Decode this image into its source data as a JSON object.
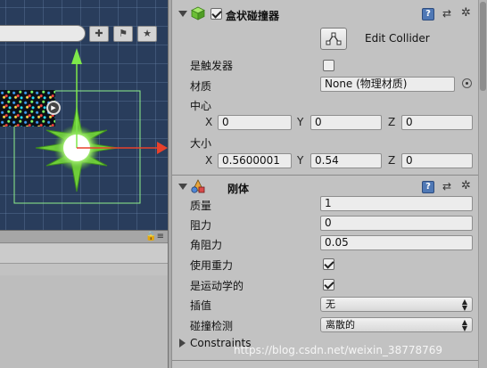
{
  "inspector": {
    "box_collider": {
      "title": "盒状碰撞器",
      "enabled": true,
      "edit_collider_label": "Edit Collider",
      "is_trigger_label": "是触发器",
      "is_trigger": false,
      "material_label": "材质",
      "material_value": "None (物理材质)",
      "center_label": "中心",
      "center": {
        "x_label": "X",
        "x": "0",
        "y_label": "Y",
        "y": "0",
        "z_label": "Z",
        "z": "0"
      },
      "size_label": "大小",
      "size": {
        "x_label": "X",
        "x": "0.5600001",
        "y_label": "Y",
        "y": "0.54",
        "z_label": "Z",
        "z": "0"
      }
    },
    "rigidbody": {
      "title": "刚体",
      "mass_label": "质量",
      "mass": "1",
      "drag_label": "阻力",
      "drag": "0",
      "angular_drag_label": "角阻力",
      "angular_drag": "0.05",
      "use_gravity_label": "使用重力",
      "use_gravity": true,
      "is_kinematic_label": "是运动学的",
      "is_kinematic": true,
      "interpolate_label": "插值",
      "interpolate_value": "无",
      "collision_detection_label": "碰撞检测",
      "collision_detection_value": "离散的",
      "constraints_label": "Constraints"
    },
    "help_glyph": "?",
    "preset_glyph": "⇄",
    "gear_glyph": "✲"
  },
  "project": {
    "lock_menu": "🔒≡",
    "filter_icons": [
      "✚",
      "⚑",
      "★"
    ],
    "play_glyph": "▶"
  },
  "icons": {
    "box_collider_icon": "green-cube-icon",
    "rigidbody_icon": "rigidbody-shapes-icon",
    "edit_collider_icon": "edit-bounds-icon"
  },
  "colors": {
    "scene_bg": "#293d5c",
    "gizmo_y": "#7ee84a",
    "gizmo_x": "#e8412b",
    "collider_outline": "#8ef08a"
  },
  "watermark": "https://blog.csdn.net/weixin_38778769"
}
